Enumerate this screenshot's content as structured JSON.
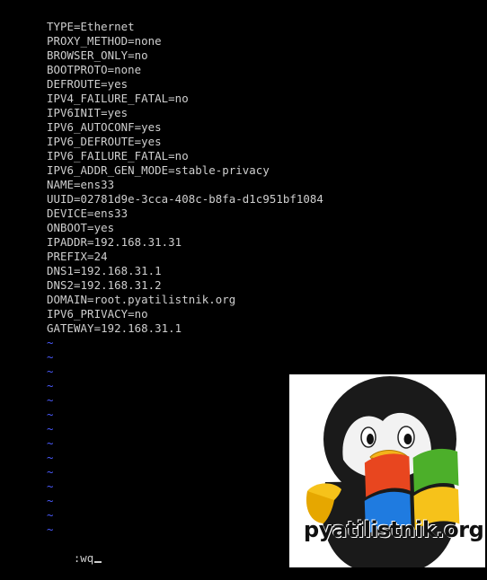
{
  "editor": {
    "lines": [
      "TYPE=Ethernet",
      "PROXY_METHOD=none",
      "BROWSER_ONLY=no",
      "BOOTPROTO=none",
      "DEFROUTE=yes",
      "IPV4_FAILURE_FATAL=no",
      "IPV6INIT=yes",
      "IPV6_AUTOCONF=yes",
      "IPV6_DEFROUTE=yes",
      "IPV6_FAILURE_FATAL=no",
      "IPV6_ADDR_GEN_MODE=stable-privacy",
      "NAME=ens33",
      "UUID=02781d9e-3cca-408c-b8fa-d1c951bf1084",
      "DEVICE=ens33",
      "ONBOOT=yes",
      "IPADDR=192.168.31.31",
      "PREFIX=24",
      "DNS1=192.168.31.1",
      "DNS2=192.168.31.2",
      "DOMAIN=root.pyatilistnik.org",
      "IPV6_PRIVACY=no",
      "GATEWAY=192.168.31.1"
    ],
    "empty_line_marker": "~",
    "empty_line_count": 14,
    "command": ":wq"
  },
  "logo": {
    "text": "pyatilistnik.org",
    "colors": {
      "red": "#e8461f",
      "green": "#4caf2a",
      "blue": "#1f7be0",
      "yellow": "#f6c21a"
    },
    "icon": "penguin-windows-logo"
  },
  "colors": {
    "background": "#000000",
    "text": "#cfcfcf",
    "tilde": "#4a5bff"
  }
}
